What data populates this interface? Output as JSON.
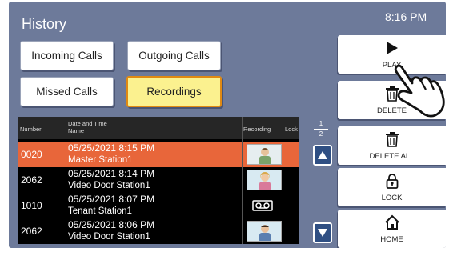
{
  "header": {
    "title": "History",
    "time": "8:16 PM"
  },
  "tabs": [
    {
      "label": "Incoming Calls",
      "active": false
    },
    {
      "label": "Outgoing Calls",
      "active": false
    },
    {
      "label": "Missed Calls",
      "active": false
    },
    {
      "label": "Recordings",
      "active": true
    }
  ],
  "table": {
    "columns": {
      "number": "Number",
      "datetime_line1": "Date and Time",
      "datetime_line2": "Name",
      "recording": "Recording",
      "lock": "Lock"
    },
    "rows": [
      {
        "number": "0020",
        "datetime": "05/25/2021   8:15 PM",
        "name": "Master Station1",
        "recording": "video",
        "selected": true
      },
      {
        "number": "2062",
        "datetime": "05/25/2021   8:14 PM",
        "name": "Video Door Station1",
        "recording": "video",
        "selected": false
      },
      {
        "number": "1010",
        "datetime": "05/25/2021   8:07 PM",
        "name": "Tenant Station1",
        "recording": "voicemail-icon",
        "selected": false
      },
      {
        "number": "2062",
        "datetime": "05/25/2021   8:06 PM",
        "name": "Video Door Station1",
        "recording": "video",
        "selected": false
      }
    ]
  },
  "pagination": {
    "current": "1",
    "total": "2"
  },
  "side_buttons": {
    "play": "PLAY",
    "delete": "DELETE",
    "delete_all": "DELETE ALL",
    "lock": "LOCK",
    "home": "HOME"
  },
  "colors": {
    "background": "#6d7a9a",
    "selected_row": "#e8663a",
    "active_tab": "#fbf18f",
    "scroll_button": "#2f4f83"
  }
}
